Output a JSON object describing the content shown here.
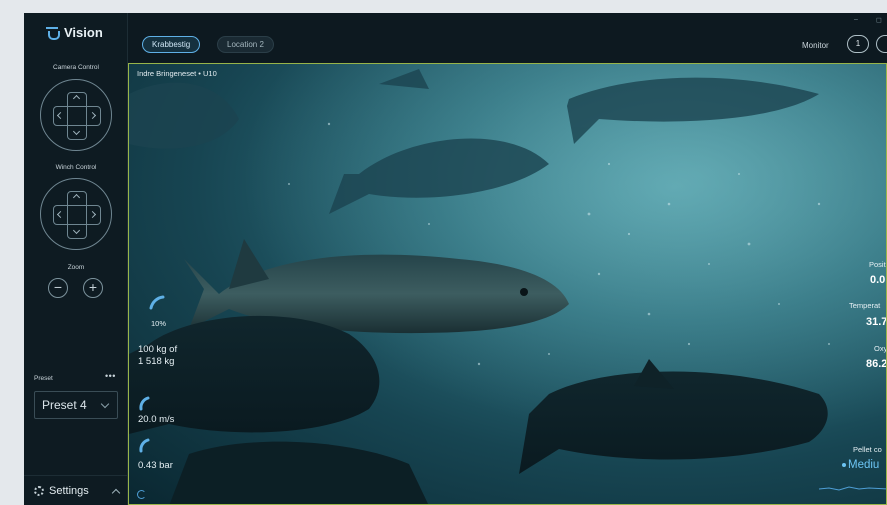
{
  "app": {
    "name": "Vision",
    "accent": "#5fb0e6",
    "highlight": "#98b449"
  },
  "sidebar": {
    "camera_control_label": "Camera Control",
    "winch_control_label": "Winch Control",
    "zoom_label": "Zoom",
    "zoom_out_symbol": "−",
    "zoom_in_symbol": "+",
    "preset_label": "Preset",
    "preset_menu": "•••",
    "preset_selected": "Preset 4",
    "settings_label": "Settings"
  },
  "topbar": {
    "tabs": [
      {
        "label": "Krabbestig",
        "active": true
      },
      {
        "label": "Location 2",
        "active": false
      }
    ],
    "monitor_label": "Monitor",
    "monitor_options": [
      "1"
    ],
    "window_controls": [
      "–",
      "◻"
    ]
  },
  "video": {
    "camera_label": "Indre Bringeneset • U10",
    "stats_left": {
      "fill_percent": "10%",
      "fill_fraction": 0.1,
      "feed_amount": "100 kg of",
      "feed_total": "1 518 kg",
      "speed": "20.0 m/s",
      "pressure": "0.43 bar"
    },
    "stats_right": {
      "position_label": "Positi",
      "position_value": "0.0",
      "temperature_label": "Temperat",
      "temperature_value": "31.7",
      "oxygen_label": "Oxyg",
      "oxygen_value": "86.2",
      "pellet_label": "Pellet co",
      "pellet_value": "Mediu"
    }
  }
}
